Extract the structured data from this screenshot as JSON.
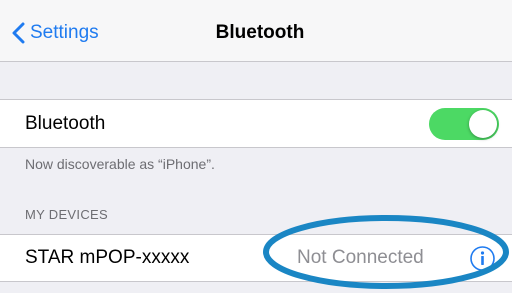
{
  "nav": {
    "back_label": "Settings",
    "title": "Bluetooth"
  },
  "bluetooth_row": {
    "label": "Bluetooth",
    "toggle_on": true
  },
  "discoverable_text": "Now discoverable as “iPhone”.",
  "my_devices": {
    "header": "MY DEVICES",
    "items": [
      {
        "name": "STAR mPOP-xxxxx",
        "status": "Not Connected",
        "icon": "info-icon"
      }
    ]
  },
  "colors": {
    "accent": "#1f7bf0",
    "toggle_on": "#4cd964",
    "highlight_ellipse": "#1a86c4"
  }
}
